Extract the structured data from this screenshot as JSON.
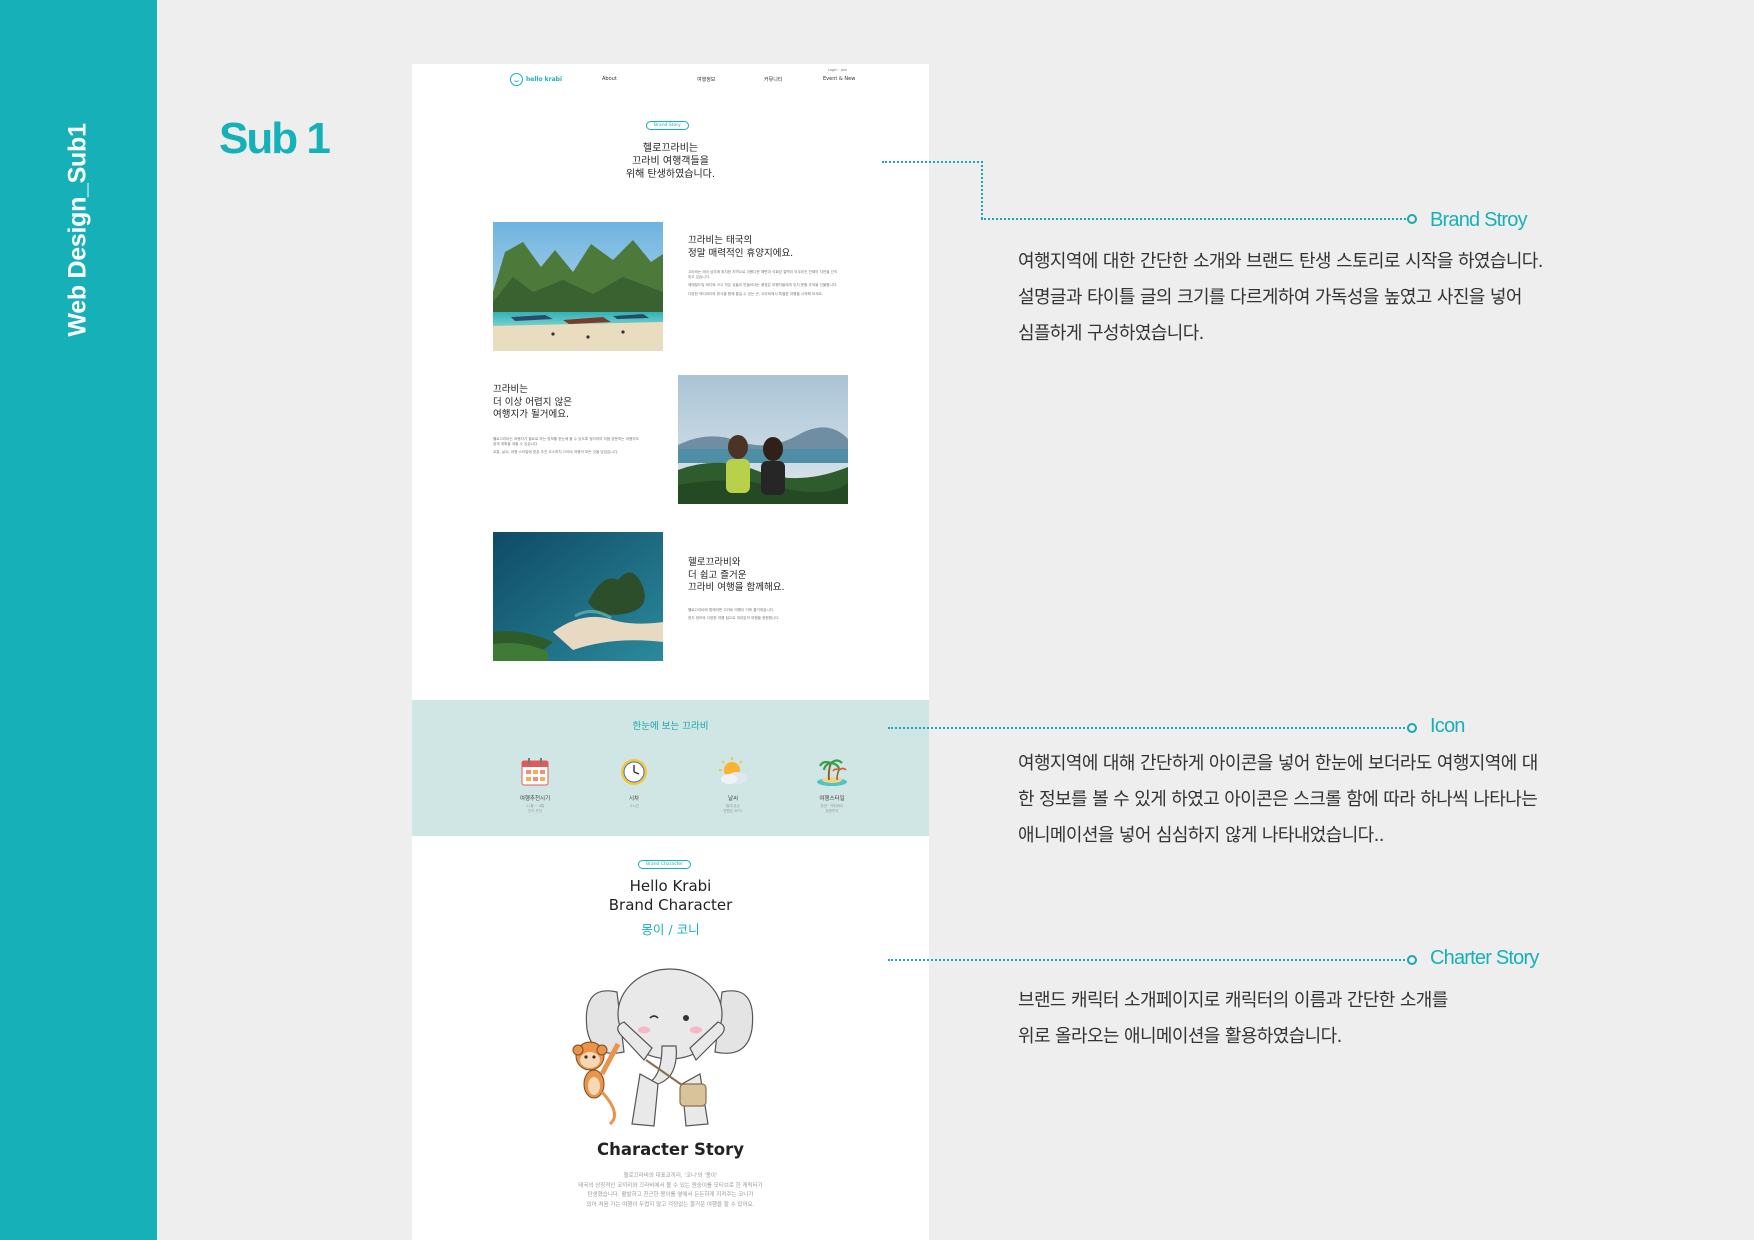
{
  "sidebar": {
    "vertical_title": "Web Design_Sub1",
    "color": "#16b1b8"
  },
  "page": {
    "heading": "Sub 1"
  },
  "mockup": {
    "nav": {
      "logo_text": "hello krabi",
      "items": [
        "About",
        "여행정보",
        "커뮤니티",
        "Event & New"
      ],
      "utility": "Login · Join"
    },
    "brand_story": {
      "pill": "Brand Story",
      "title_lines": [
        "헬로끄라비는",
        "끄라비 여행객들을",
        "위해 탄생하였습니다."
      ]
    },
    "blocks": [
      {
        "head_lines": [
          "끄라비는 태국의",
          "정말 매력적인 휴양지에요."
        ],
        "body": [
          "끄라비는 태국 남부에 위치한 지역으로 아름다운 해변과 석회암 절벽이 어우러진 천혜의 자연을 간직하고 있습니다.",
          "에메랄드빛 바다와 크고 작은 섬들이 만들어내는 풍경은 여행자들에게 잊지 못할 추억을 선물합니다.",
          "다양한 액티비티와 휴식을 함께 즐길 수 있는 곳, 끄라비에서 특별한 여행을 시작해 보세요."
        ]
      },
      {
        "head_lines": [
          "끄라비는",
          "더 이상 어렵지 않은",
          "여행지가 될거에요."
        ],
        "body": [
          "헬로끄라비는 여행자가 필요로 하는 정보를 한눈에 볼 수 있도록 정리하여 처음 방문하는 여행자도 쉽게 계획을 세울 수 있습니다.",
          "교통, 날씨, 여행 스타일에 맞춘 추천 코스까지 끄라비 여행의 모든 것을 담았습니다."
        ]
      },
      {
        "head_lines": [
          "헬로끄라비와",
          "더 쉽고 즐거운",
          "끄라비 여행을 함께해요."
        ],
        "body": [
          "헬로끄라비와 함께라면 끄라비 여행이 더욱 즐거워집니다.",
          "현지 정보와 다양한 여행 팁으로 여러분의 여행을 응원합니다."
        ]
      }
    ],
    "icon_band": {
      "title": "한눈에 보는 끄라비",
      "color": "#cfe6e4",
      "items": [
        {
          "icon": "calendar-icon",
          "label": "여행추천시기",
          "desc_lines": [
            "11월 ~ 4월",
            "건기 추천"
          ]
        },
        {
          "icon": "clock-icon",
          "label": "시차",
          "desc_lines": [
            "-2시간"
          ]
        },
        {
          "icon": "weather-icon",
          "label": "날씨",
          "desc_lines": [
            "열대 몬순",
            "연평균 28°C"
          ]
        },
        {
          "icon": "island-icon",
          "label": "여행스타일",
          "desc_lines": [
            "휴양 · 액티비티",
            "호핑투어"
          ]
        }
      ]
    },
    "brand_character": {
      "pill": "Brand Character",
      "title_lines": [
        "Hello Krabi",
        "Brand Character"
      ],
      "names": "몽이 / 코니",
      "story_title": "Character Story",
      "story_lines": [
        "헬로끄라비의 대표코끼리, '코니'와 '몽이'",
        "태국의 상징적인 코끼리와 끄라비에서 볼 수 있는 원숭이를 모티브로 한 캐릭터가",
        "탄생했습니다. 활발하고 친근한 몽이를 옆에서 든든하게 지켜주는 코니가",
        "있어 처음 가는 여행이 두렵지 않고 걱정없는 즐거운 여행을 할 수 있어요."
      ]
    }
  },
  "annotations": [
    {
      "title": "Brand Stroy",
      "lines": [
        "여행지역에 대한 간단한 소개와 브랜드 탄생 스토리로 시작을 하였습니다.",
        "설명글과 타이틀 글의 크기를 다르게하여 가독성을 높였고 사진을 넣어",
        "심플하게 구성하였습니다."
      ]
    },
    {
      "title": "Icon",
      "lines": [
        "여행지역에 대해 간단하게 아이콘을 넣어 한눈에 보더라도 여행지역에 대",
        "한 정보를 볼  수 있게 하였고 아이콘은  스크롤 함에 따라 하나씩 나타나는",
        "애니메이션을 넣어 심심하지 않게 나타내었습니다.."
      ]
    },
    {
      "title": "Charter Story",
      "lines": [
        "브랜드  캐릭터  소개페이지로 캐릭터의 이름과 간단한 소개를",
        "위로 올라오는  애니메이션을 활용하였습니다."
      ]
    }
  ],
  "accent_color": "#16b1b8"
}
